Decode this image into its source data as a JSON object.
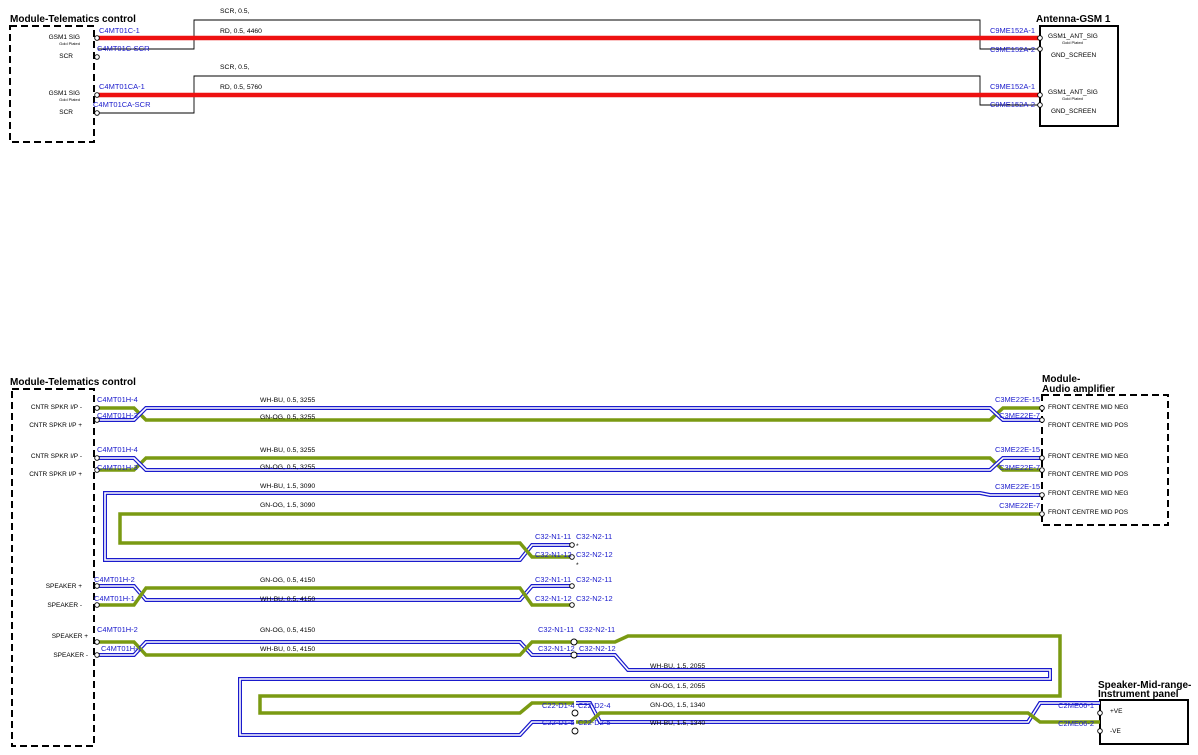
{
  "diagram": {
    "colors": {
      "red_wire": "#ee1111",
      "green_wire": "#7a9a12",
      "blue_wire": "#1a1acc",
      "connector_text": "#1a1acc",
      "shield": "#000000"
    },
    "top": {
      "modules": {
        "telematics": "Module-Telematics control",
        "antenna": "Antenna-GSM 1"
      },
      "circuits": [
        {
          "left_pins": [
            {
              "label": "GSM1 SIG",
              "sub": "Gold Plated",
              "connector": "C4MT01C-1"
            },
            {
              "label": "SCR",
              "sub": "",
              "connector": "C4MT01C-SCR"
            }
          ],
          "right_pins": [
            {
              "label": "GSM1_ANT_SIG",
              "sub": "Gold Plated",
              "connector": "C9ME152A-1"
            },
            {
              "label": "GND_SCREEN",
              "sub": "",
              "connector": "C9ME152A-2"
            }
          ],
          "shield_label": "SCR,  0.5,",
          "wire_label": "RD,  0.5,  4460"
        },
        {
          "left_pins": [
            {
              "label": "GSM1 SIG",
              "sub": "Gold Plated",
              "connector": "C4MT01CA-1"
            },
            {
              "label": "SCR",
              "sub": "",
              "connector": "C4MT01CA-SCR"
            }
          ],
          "right_pins": [
            {
              "label": "GSM1_ANT_SIG",
              "sub": "Gold Plated",
              "connector": "C9ME152A-1"
            },
            {
              "label": "GND_SCREEN",
              "sub": "",
              "connector": "C9ME152A-2"
            }
          ],
          "shield_label": "SCR,  0.5,",
          "wire_label": "RD,  0.5,  5760"
        }
      ]
    },
    "bottom": {
      "modules": {
        "telematics": "Module-Telematics control",
        "amplifier_line1": "Module-",
        "amplifier_line2": "Audio amplifier",
        "speaker_line1": "Speaker-Mid-range-",
        "speaker_line2": "Instrument panel"
      },
      "left_pins": [
        "CNTR SPKR I/P -",
        "CNTR SPKR I/P +",
        "CNTR SPKR I/P -",
        "CNTR SPKR I/P +",
        "SPEAKER +",
        "SPEAKER -",
        "SPEAKER +",
        "SPEAKER -"
      ],
      "amp_pins": [
        "FRONT CENTRE MID NEG",
        "FRONT CENTRE MID POS",
        "FRONT CENTRE MID NEG",
        "FRONT CENTRE MID POS",
        "FRONT CENTRE MID NEG",
        "FRONT CENTRE MID POS"
      ],
      "speaker_pins": [
        "+VE",
        "-VE"
      ],
      "connectors": {
        "p1a": "C4MT01H-4",
        "p1b": "C4MT01H-3",
        "a1a": "C3ME22E-15",
        "a1b": "C3ME22E-7",
        "p2a": "C4MT01H-4",
        "p2b": "C4MT01H-3",
        "a2a": "C3ME22E-15",
        "a2b": "C3ME22E-7",
        "a3a": "C3ME22E-15",
        "a3b": "C3ME22E-7",
        "s3a": "C32-N1-11",
        "s3b": "C32-N2-11",
        "s3c": "C32-N1-12",
        "s3d": "C32-N2-12",
        "p4a": "C4MT01H-2",
        "p4b": "C4MT01H-1",
        "s4a": "C32-N1-11",
        "s4b": "C32-N2-11",
        "s4c": "C32-N1-12",
        "s4d": "C32-N2-12",
        "p5a": "C4MT01H-2",
        "p5b": "C4MT01H-1",
        "s5a": "C32-N1-11",
        "s5b": "C32-N2-11",
        "s5c": "C32-N1-12",
        "s5d": "C32-N2-12",
        "s6a": "C22-D1-4",
        "s6b": "C22-D2-4",
        "s6c": "C22-D1-5",
        "s6d": "C22-D2-5",
        "sp1": "C2ME06-1",
        "sp2": "C2ME06-2"
      },
      "wire_labels": {
        "w1a": "WH-BU,  0.5,  3255",
        "w1b": "GN-OG,  0.5,  3255",
        "w2a": "WH-BU,  0.5,  3255",
        "w2b": "GN-OG,  0.5,  3255",
        "w3a": "WH-BU,  1.5,  3090",
        "w3b": "GN-OG,  1.5,  3090",
        "w4a": "GN-OG,  0.5,  4150",
        "w4b": "WH-BU,  0.5,  4150",
        "w5a": "GN-OG,  0.5,  4150",
        "w5b": "WH-BU,  0.5,  4150",
        "w6a": "WH-BU,  1.5,  2055",
        "w6b": "GN-OG,  1.5,  2055",
        "w7a": "GN-OG,  1.5,  1340",
        "w7b": "WH-BU,  1.5,  1340"
      },
      "splice_marks": [
        "*",
        "*"
      ]
    }
  }
}
